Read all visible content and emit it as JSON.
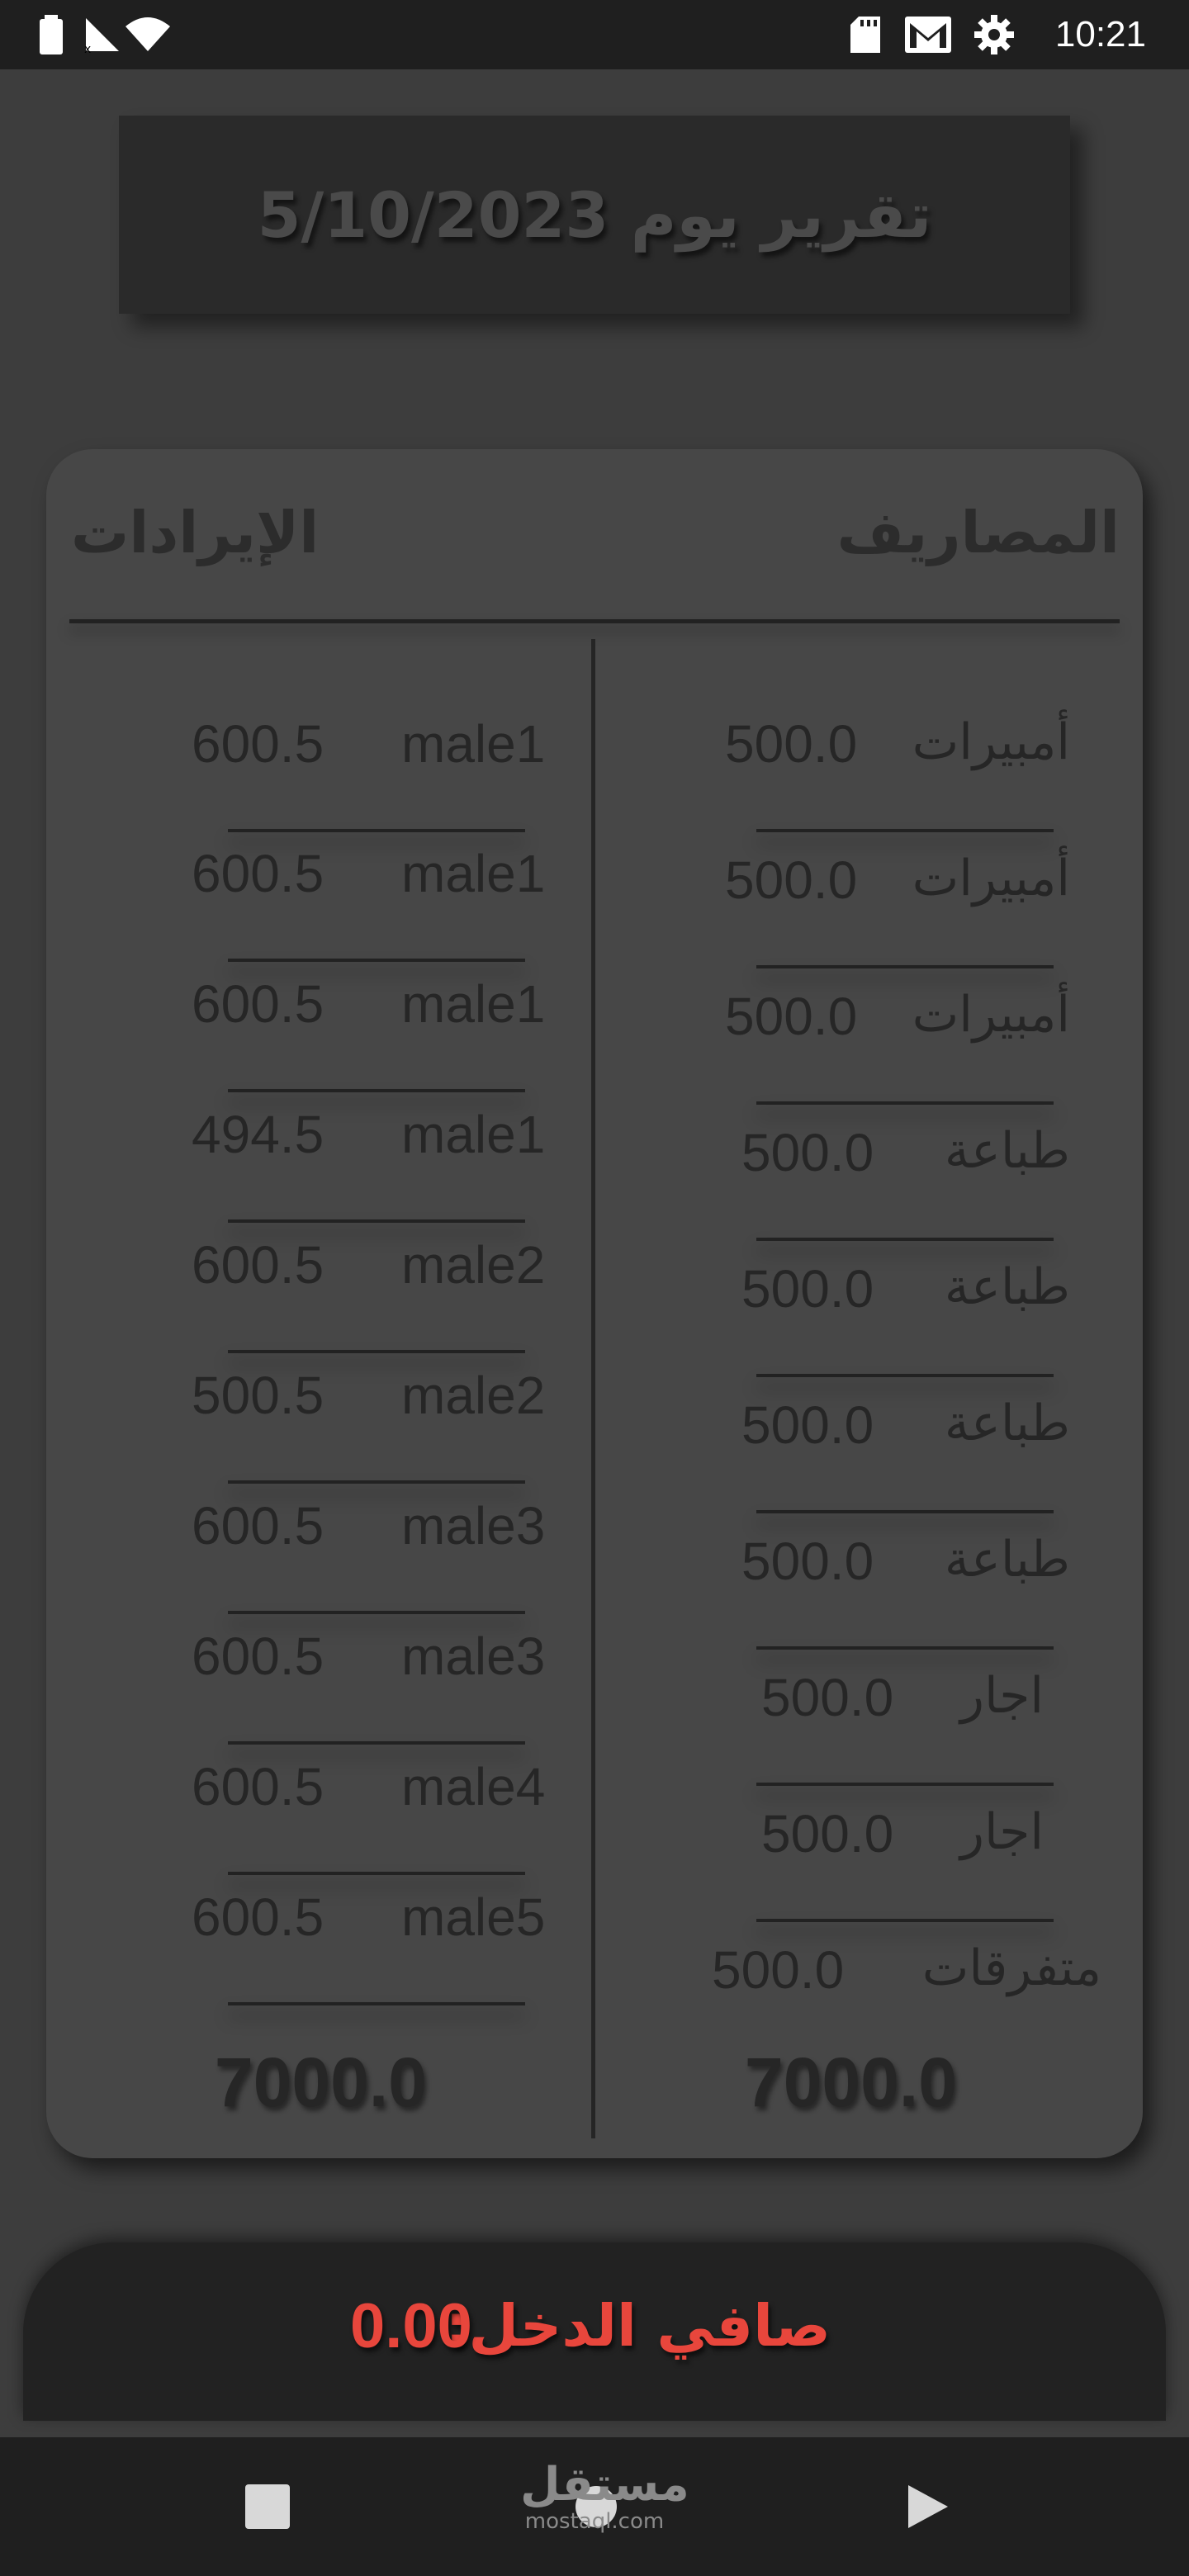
{
  "status_bar": {
    "time": "10:21"
  },
  "title": "تقرير يوم 5/10/2023",
  "report": {
    "expenses_heading": "المصاريف",
    "revenues_heading": "الإيرادات",
    "expenses": [
      {
        "label": "أمبيرات",
        "amount": "500.0"
      },
      {
        "label": "أمبيرات",
        "amount": "500.0"
      },
      {
        "label": "أمبيرات",
        "amount": "500.0"
      },
      {
        "label": "طباعة",
        "amount": "500.0"
      },
      {
        "label": "طباعة",
        "amount": "500.0"
      },
      {
        "label": "طباعة",
        "amount": "500.0"
      },
      {
        "label": "طباعة",
        "amount": "500.0"
      },
      {
        "label": "اجار",
        "amount": "500.0"
      },
      {
        "label": "اجار",
        "amount": "500.0"
      },
      {
        "label": "متفرقات",
        "amount": "500.0"
      }
    ],
    "revenues": [
      {
        "label": "male1",
        "amount": "600.5"
      },
      {
        "label": "male1",
        "amount": "600.5"
      },
      {
        "label": "male1",
        "amount": "600.5"
      },
      {
        "label": "male1",
        "amount": "494.5"
      },
      {
        "label": "male2",
        "amount": "600.5"
      },
      {
        "label": "male2",
        "amount": "500.5"
      },
      {
        "label": "male3",
        "amount": "600.5"
      },
      {
        "label": "male3",
        "amount": "600.5"
      },
      {
        "label": "male4",
        "amount": "600.5"
      },
      {
        "label": "male5",
        "amount": "600.5"
      }
    ],
    "expenses_total": "7000.0",
    "revenues_total": "7000.0"
  },
  "net_income": {
    "label": "صافي الدخل:",
    "value": "0.00"
  },
  "watermark": {
    "arabic": "مستقل",
    "latin": "mostaql.com"
  },
  "colors": {
    "accent": "#e8463c",
    "background": "#3d3d3d",
    "card": "#474747"
  }
}
